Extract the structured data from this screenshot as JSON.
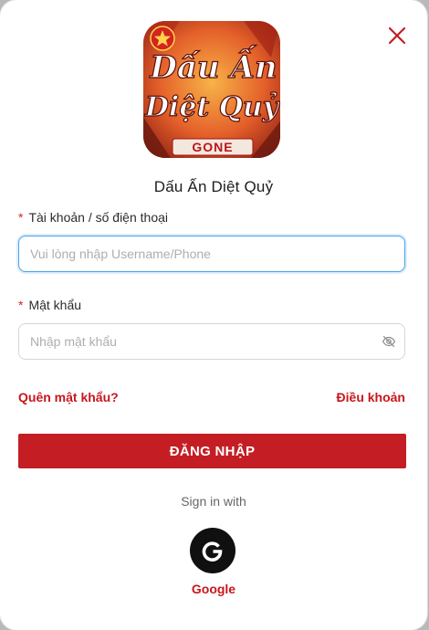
{
  "game": {
    "title": "Dấu Ấn Diệt Quỷ",
    "logo_text_line1": "Dấu Ấn",
    "logo_text_line2": "Diệt Quỷ",
    "logo_badge": "GONE"
  },
  "form": {
    "account_label": "Tài khoản / số điện thoại",
    "account_placeholder": "Vui lòng nhập Username/Phone",
    "account_value": "",
    "password_label": "Mật khẩu",
    "password_placeholder": "Nhập mật khẩu",
    "password_value": "",
    "required_mark": "*"
  },
  "links": {
    "forgot_password": "Quên mật khẩu?",
    "terms": "Điều khoản"
  },
  "actions": {
    "login_label": "ĐĂNG NHẬP",
    "sign_in_with": "Sign in with",
    "google_label": "Google"
  },
  "icons": {
    "close": "close-icon",
    "eye": "eye-off-icon",
    "google": "google-icon"
  },
  "colors": {
    "accent": "#c41e24",
    "link": "#c8161d",
    "focus": "#4aa3ea"
  }
}
